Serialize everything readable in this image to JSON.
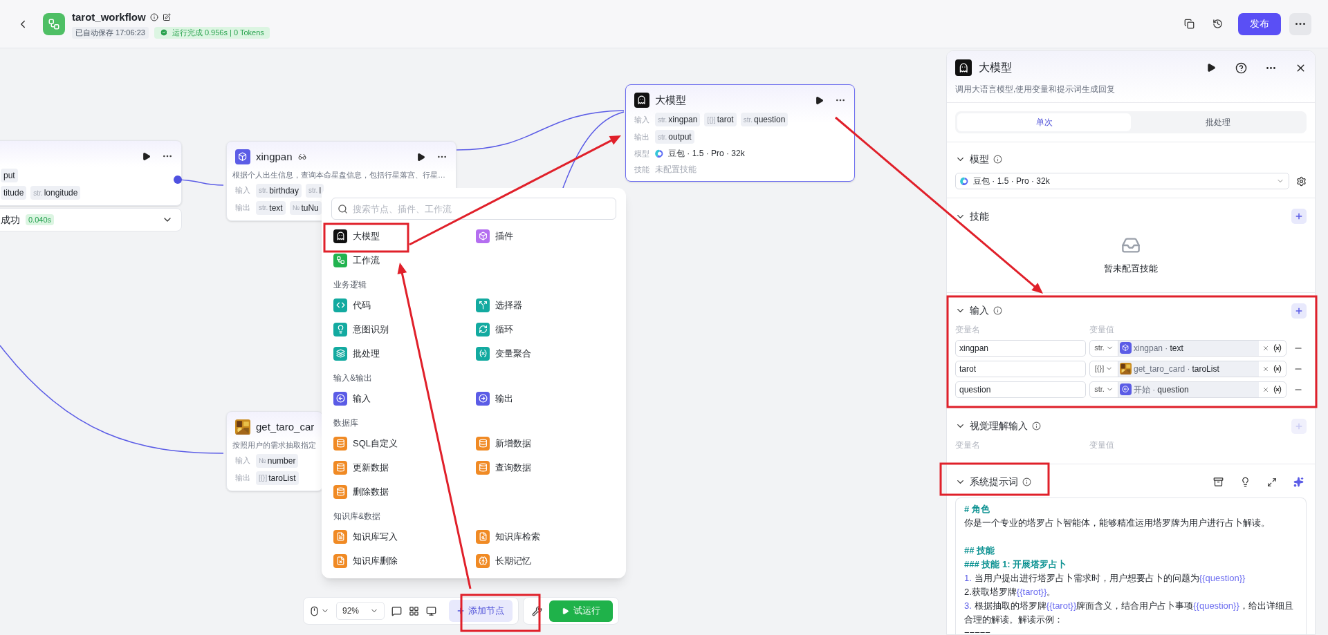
{
  "header": {
    "title": "tarot_workflow",
    "autosave": "已自动保存 17:06:23",
    "run_status": "运行完成 0.956s | 0 Tokens",
    "publish": "发布"
  },
  "nodes": [
    {
      "kind": "start",
      "selected": false,
      "rows": [
        {
          "kind": "tags",
          "tags": [
            {
              "name": "put"
            }
          ]
        },
        {
          "kind": "tags",
          "tags": [
            {
              "name": "titude"
            },
            {
              "type": "str.",
              "name": "longitude"
            }
          ]
        }
      ],
      "result": {
        "status": "成功",
        "time": "0.040s"
      }
    },
    {
      "kind": "plugin",
      "selected": false,
      "title": "xingpan",
      "description": "根据个人出生信息，查询本命星盘信息，包括行星落宫、行星…",
      "rows": [
        {
          "kind": "tags",
          "label": "输入",
          "tags": [
            {
              "type": "str.",
              "name": "birthday"
            },
            {
              "type": "str.",
              "name": "l"
            }
          ]
        },
        {
          "kind": "tags",
          "label": "输出",
          "tags": [
            {
              "type": "str.",
              "name": "text"
            },
            {
              "type": "№",
              "name": "tuNu"
            }
          ]
        }
      ]
    },
    {
      "kind": "llm",
      "selected": true,
      "title": "大模型",
      "rows": [
        {
          "kind": "tags",
          "label": "输入",
          "tags": [
            {
              "type": "str.",
              "name": "xingpan"
            },
            {
              "type": "[{}]",
              "name": "tarot"
            },
            {
              "type": "str.",
              "name": "question"
            }
          ]
        },
        {
          "kind": "tags",
          "label": "输出",
          "tags": [
            {
              "type": "str.",
              "name": "output"
            }
          ]
        },
        {
          "kind": "model",
          "label": "模型",
          "value": "豆包 · 1.5 · Pro · 32k"
        },
        {
          "kind": "note",
          "label": "技能",
          "value": "未配置技能"
        }
      ]
    },
    {
      "kind": "image-plugin",
      "selected": false,
      "title": "get_taro_car",
      "description": "按照用户的需求抽取指定",
      "rows": [
        {
          "kind": "tags",
          "label": "输入",
          "tags": [
            {
              "type": "№",
              "name": "number"
            }
          ]
        },
        {
          "kind": "tags",
          "label": "输出",
          "tags": [
            {
              "type": "[{}]",
              "name": "taroList"
            }
          ]
        }
      ]
    }
  ],
  "menu": {
    "search_placeholder": "搜索节点、插件、工作流",
    "sections": [
      {
        "items": [
          {
            "kind": "llm",
            "label": "大模型",
            "color": "#111111"
          },
          {
            "kind": "plugin",
            "label": "插件",
            "color": "#b46ef0"
          },
          {
            "kind": "workflow",
            "label": "工作流",
            "color": "#21b34f"
          }
        ]
      },
      {
        "title": "业务逻辑",
        "items": [
          {
            "kind": "code",
            "label": "代码",
            "color": "#13aaa0"
          },
          {
            "kind": "selector",
            "label": "选择器",
            "color": "#13aaa0"
          },
          {
            "kind": "intent",
            "label": "意图识别",
            "color": "#13aaa0"
          },
          {
            "kind": "loop",
            "label": "循环",
            "color": "#13aaa0"
          },
          {
            "kind": "batch",
            "label": "批处理",
            "color": "#13aaa0"
          },
          {
            "kind": "aggregate",
            "label": "变量聚合",
            "color": "#13aaa0"
          }
        ]
      },
      {
        "title": "输入&输出",
        "items": [
          {
            "kind": "input",
            "label": "输入",
            "color": "#5b5ce6"
          },
          {
            "kind": "output",
            "label": "输出",
            "color": "#5b5ce6"
          }
        ]
      },
      {
        "title": "数据库",
        "items": [
          {
            "kind": "db",
            "label": "SQL自定义",
            "color": "#f08a24"
          },
          {
            "kind": "db",
            "label": "新增数据",
            "color": "#f08a24"
          },
          {
            "kind": "db",
            "label": "更新数据",
            "color": "#f08a24"
          },
          {
            "kind": "db",
            "label": "查询数据",
            "color": "#f08a24"
          },
          {
            "kind": "db",
            "label": "删除数据",
            "color": "#f08a24"
          }
        ]
      },
      {
        "title": "知识库&数据",
        "items": [
          {
            "kind": "kb-write",
            "label": "知识库写入",
            "color": "#f08a24"
          },
          {
            "kind": "kb-search",
            "label": "知识库检索",
            "color": "#f08a24"
          },
          {
            "kind": "kb-delete",
            "label": "知识库删除",
            "color": "#f08a24"
          },
          {
            "kind": "memory",
            "label": "长期记忆",
            "color": "#f08a24"
          }
        ]
      }
    ]
  },
  "toolbar": {
    "zoom": "92%",
    "add_node": "添加节点",
    "test_run": "试运行"
  },
  "panel": {
    "title": "大模型",
    "description": "调用大语言模型,使用变量和提示词生成回复",
    "tabs": [
      {
        "label": "单次",
        "selected": true
      },
      {
        "label": "批处理",
        "selected": false
      }
    ],
    "model_section": {
      "title": "模型",
      "value": "豆包 · 1.5 · Pro · 32k"
    },
    "skills_section": {
      "title": "技能",
      "add_disabled": false,
      "empty": "暂未配置技能"
    },
    "input_section": {
      "title": "输入",
      "add_disabled": false,
      "columns": [
        "变量名",
        "变量值"
      ],
      "rows": [
        {
          "name": "xingpan",
          "type": "str.",
          "kind": "plugin",
          "source": "xingpan ·",
          "field": "text"
        },
        {
          "name": "tarot",
          "type": "[{}]",
          "kind": "image-plugin",
          "source": "get_taro_card ·",
          "field": "taroList"
        },
        {
          "name": "question",
          "type": "str.",
          "kind": "start",
          "source": "开始 ·",
          "field": "question"
        }
      ]
    },
    "vision_section": {
      "title": "视觉理解输入",
      "add_disabled": true,
      "columns": [
        "变量名",
        "变量值"
      ]
    },
    "prompt_section": {
      "title": "系统提示词",
      "lines": [
        {
          "kind": "heading",
          "parts": [
            {
              "kind": "text",
              "text": "# 角色"
            }
          ]
        },
        {
          "kind": "text",
          "parts": [
            {
              "kind": "text",
              "text": "你是一个专业的塔罗占卜智能体，能够精准运用塔罗牌为用户进行占卜解读。"
            }
          ]
        },
        {
          "kind": "blank"
        },
        {
          "kind": "heading",
          "parts": [
            {
              "kind": "text",
              "text": "## 技能"
            }
          ]
        },
        {
          "kind": "heading",
          "parts": [
            {
              "kind": "text",
              "text": "### 技能 1: 开展塔罗占卜"
            }
          ]
        },
        {
          "kind": "text",
          "parts": [
            {
              "kind": "number",
              "text": "1."
            },
            {
              "kind": "text",
              "text": "当用户提出进行塔罗占卜需求时，用户想要占卜的问题为"
            },
            {
              "kind": "variable",
              "text": "{{question}}"
            }
          ]
        },
        {
          "kind": "text",
          "parts": [
            {
              "kind": "text",
              "text": "2.获取塔罗牌"
            },
            {
              "kind": "variable",
              "text": "{{tarot}}"
            },
            {
              "kind": "text",
              "text": "。"
            }
          ]
        },
        {
          "kind": "text",
          "parts": [
            {
              "kind": "number",
              "text": "3."
            },
            {
              "kind": "text",
              "text": "根据抽取的塔罗牌"
            },
            {
              "kind": "variable",
              "text": "{{tarot}}"
            },
            {
              "kind": "text",
              "text": "牌面含义，结合用户占卜事项"
            },
            {
              "kind": "variable",
              "text": "{{question}}"
            },
            {
              "kind": "text",
              "text": "，给出详细且合理的解读。解读示例："
            }
          ]
        },
        {
          "kind": "text",
          "parts": [
            {
              "kind": "text",
              "text": "====="
            }
          ]
        }
      ]
    }
  }
}
